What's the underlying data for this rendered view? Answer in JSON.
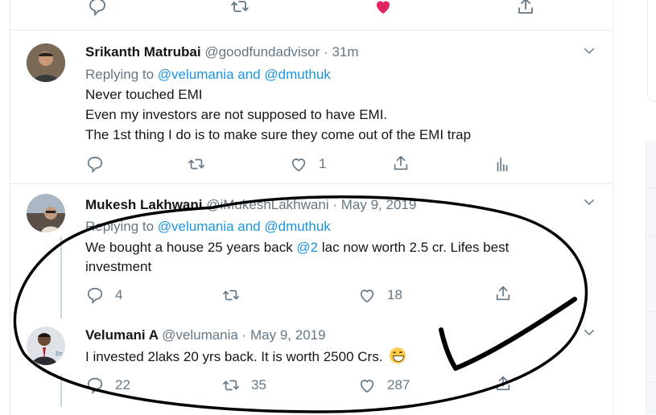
{
  "top_actions": {
    "like_color": "#e0245e"
  },
  "tweets": [
    {
      "name": "Srikanth Matrubai",
      "handle": "@goodfundadvisor",
      "sep": "·",
      "time": "31m",
      "replying_prefix": "Replying to",
      "replying_users": "@velumania and @dmuthuk",
      "lines": [
        "Never touched EMI",
        "Even my investors are not supposed to have EMI.",
        "The 1st thing I do is to make sure they come out of the EMI trap"
      ],
      "likes": "1"
    },
    {
      "name": "Mukesh Lakhwani",
      "handle": "@iMukeshLakhwani",
      "sep": "·",
      "time": "May 9, 2019",
      "replying_prefix": "Replying to",
      "replying_users": "@velumania and @dmuthuk",
      "line1_a": "We bought a house 25 years back ",
      "line1_mention": "@2",
      "line1_b": " lac now worth 2.5 cr. Lifes best",
      "line2": "investment",
      "replies": "4",
      "likes": "18"
    },
    {
      "name": "Velumani A",
      "handle": "@velumania",
      "sep": "·",
      "time": "May 9, 2019",
      "text": "I invested 2laks 20 yrs back. It is worth 2500 Crs.",
      "replies": "22",
      "retweets": "35",
      "likes": "287"
    }
  ],
  "colors": {
    "link": "#1b95e0",
    "muted": "#657786",
    "annotation": "#000000"
  }
}
